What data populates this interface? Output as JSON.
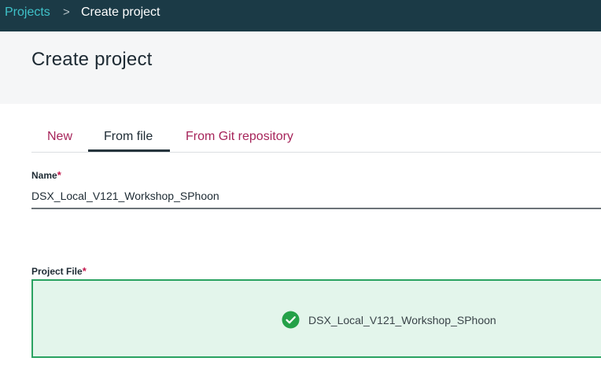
{
  "breadcrumb": {
    "root": "Projects",
    "separator": ">",
    "current": "Create project"
  },
  "page": {
    "title": "Create project"
  },
  "tabs": [
    {
      "label": "New",
      "selected": false
    },
    {
      "label": "From file",
      "selected": true
    },
    {
      "label": "From Git repository",
      "selected": false
    }
  ],
  "form": {
    "name": {
      "label": "Name",
      "required_mark": "*",
      "value": "DSX_Local_V121_Workshop_SPhoon"
    },
    "project_file": {
      "label": "Project File",
      "required_mark": "*",
      "file_name": "DSX_Local_V121_Workshop_SPhoon",
      "status_icon": "check-circle-icon"
    }
  },
  "colors": {
    "topbar": "#1b3a46",
    "link": "#3fc2c9",
    "tab_link": "#a6245a",
    "success": "#2aa261",
    "success_bg": "#e3f5eb",
    "required": "#c2154b"
  }
}
